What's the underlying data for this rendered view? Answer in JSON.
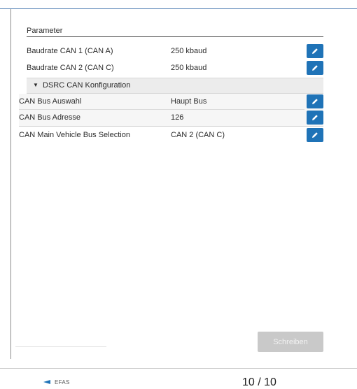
{
  "panel": {
    "header": "Parameter",
    "rows": [
      {
        "label": "Baudrate CAN 1 (CAN A)",
        "value": "250 kbaud"
      },
      {
        "label": "Baudrate CAN 2 (CAN C)",
        "value": "250 kbaud"
      }
    ],
    "section": {
      "title": "DSRC CAN Konfiguration",
      "rows": [
        {
          "label": "CAN Bus Auswahl",
          "value": "Haupt Bus"
        },
        {
          "label": "CAN Bus Adresse",
          "value": "126"
        }
      ]
    },
    "extra_row": {
      "label": "CAN Main Vehicle Bus Selection",
      "value": "CAN 2 (CAN C)"
    },
    "write_button": "Schreiben"
  },
  "footer": {
    "brand": "EFAS",
    "page_indicator": "10 / 10"
  },
  "colors": {
    "accent": "#1f73b7",
    "disabled_button": "#c9c9c9",
    "section_bg": "#ececec"
  },
  "icons": {
    "edit": "pencil-icon",
    "collapse": "triangle-down-icon"
  }
}
